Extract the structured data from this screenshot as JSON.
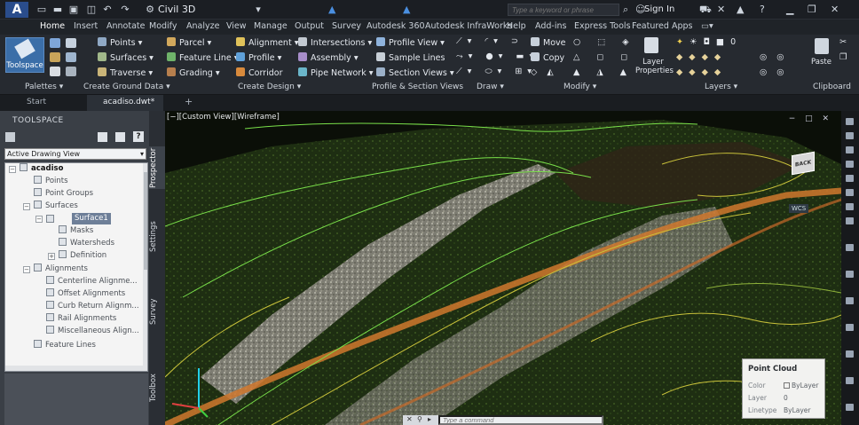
{
  "app": {
    "logo": "A",
    "title": "Civil 3D",
    "search_placeholder": "Type a keyword or phrase",
    "signin": "Sign In"
  },
  "ribbon_tabs": [
    "Home",
    "Insert",
    "Annotate",
    "Modify",
    "Analyze",
    "View",
    "Manage",
    "Output",
    "Survey",
    "Autodesk 360",
    "Autodesk InfraWorks",
    "Help",
    "Add-ins",
    "Express Tools",
    "Featured Apps"
  ],
  "ribbon": {
    "toolspace_label": "Toolspace",
    "ground_data": [
      "Points",
      "Surfaces",
      "Traverse"
    ],
    "design_col1": [
      "Parcel",
      "Feature Line",
      "Grading"
    ],
    "design_col2": [
      "Alignment",
      "Profile",
      "Corridor"
    ],
    "design_col3": [
      "Intersections",
      "Assembly",
      "Pipe Network"
    ],
    "profile_section": [
      "Profile View",
      "Sample Lines",
      "Section Views"
    ],
    "modify": [
      "Move",
      "Copy"
    ],
    "layer_properties": [
      "Layer",
      "Properties"
    ],
    "layer_value": "0",
    "paste_label": "Paste",
    "panel_titles": [
      "Palettes",
      "Create Ground Data",
      "Create Design",
      "Profile & Section Views",
      "Draw",
      "Modify",
      "Layers",
      "Clipboard"
    ]
  },
  "doc_tabs": {
    "start": "Start",
    "active": "acadiso.dwt*",
    "add": "+"
  },
  "toolspace": {
    "header": "TOOLSPACE",
    "view_select": "Active Drawing View",
    "tree": {
      "root": "acadiso",
      "points": "Points",
      "point_groups": "Point Groups",
      "surfaces": "Surfaces",
      "surface1": "Surface1",
      "masks": "Masks",
      "watersheds": "Watersheds",
      "definition": "Definition",
      "alignments": "Alignments",
      "centerline": "Centerline Alignme...",
      "offset": "Offset Alignments",
      "curb": "Curb Return Alignm...",
      "rail": "Rail Alignments",
      "misc": "Miscellaneous Align...",
      "feature_lines": "Feature Lines"
    },
    "side_tabs": [
      "Prospector",
      "Settings",
      "Survey",
      "Toolbox"
    ]
  },
  "viewport": {
    "view_label": "[−][Custom View][Wireframe]",
    "viewcube_face": "BACK",
    "wcs": "WCS",
    "controls": "− □ ✕"
  },
  "properties": {
    "title": "Point Cloud",
    "color_label": "Color",
    "color_value": "ByLayer",
    "layer_label": "Layer",
    "layer_value": "0",
    "linetype_label": "Linetype",
    "linetype_value": "ByLayer"
  },
  "command_line": {
    "placeholder": "Type a command"
  },
  "colors": {
    "ribbon_bg": "#262a30",
    "toolspace_bg": "#3a3f46",
    "selection": "#6e7f98",
    "contour_green": "#7ae04a",
    "contour_yellow": "#c9c23a",
    "road_orange": "#d0782e"
  }
}
